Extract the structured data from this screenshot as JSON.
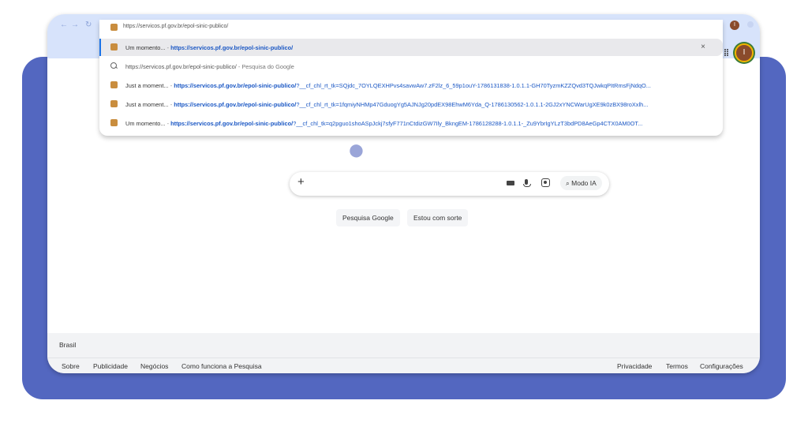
{
  "omnibox": {
    "text": "https://servicos.pf.gov.br/epol-sinic-publico/"
  },
  "suggestions": [
    {
      "title": "Um momento...",
      "sep": "-",
      "url": "https://servicos.pf.gov.br/epol-sinic-publico/",
      "rest": "",
      "type": "history",
      "selected": true,
      "remove": "×"
    },
    {
      "title": "https://servicos.pf.gov.br/epol-sinic-publico/",
      "sep": "-",
      "url": "",
      "rest": "Pesquisa do Google",
      "type": "search"
    },
    {
      "title": "Just a moment...",
      "sep": "-",
      "url": "https://servicos.pf.gov.br/epol-sinic-publico/",
      "rest": "?__cf_chl_rt_tk=SQjdc_7OYLQEXHPvs4savwAw7.zF2lz_6_59p1ouY-1786131838-1.0.1.1-GH70TyzmKZZQvd3TQJwkqPItRmsFjNdqO...",
      "type": "history"
    },
    {
      "title": "Just a moment...",
      "sep": "-",
      "url": "https://servicos.pf.gov.br/epol-sinic-publico/",
      "rest": "?__cf_chl_rt_tk=1fqmiyNHMp47GduogYg5AJNJg20pdEX98EhwM6Yda_Q-1786130562-1.0.1.1-2GJ2xYNCWarUgXE9k0zBX98roXxlh...",
      "type": "history"
    },
    {
      "title": "Um momento...",
      "sep": "-",
      "url": "https://servicos.pf.gov.br/epol-sinic-publico/",
      "rest": "?__cf_chl_tk=q2pguo1shoASpJckj7sfyF771nCtdizGW7Ily_BkngEM-1786128288-1.0.1.1-_Zu9YbrIgYLzT3bdPD8AeGp4CTX0AM0OT...",
      "type": "history"
    }
  ],
  "searchbox": {
    "plus": "+",
    "mode_label": "Modo IA",
    "mode_icon": "sparkle-search-icon"
  },
  "buttons": {
    "search": "Pesquisa Google",
    "lucky": "Estou com sorte"
  },
  "footer": {
    "country": "Brasil",
    "left_links": [
      "Sobre",
      "Publicidade",
      "Negócios",
      "Como funciona a Pesquisa"
    ],
    "right_links": [
      "Privacidade",
      "Termos",
      "Configurações"
    ]
  },
  "profile": {
    "initial": "I"
  },
  "colors": {
    "frame": "#5367c0",
    "link": "#1a57c4",
    "tabstrip": "#d7e3fb"
  }
}
